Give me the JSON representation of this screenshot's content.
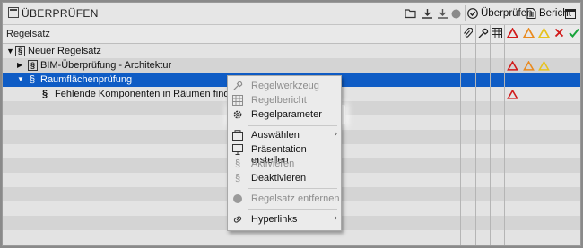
{
  "window": {
    "title": "ÜBERPRÜFEN"
  },
  "toolbar": {
    "icons": [
      "folder-open-icon",
      "download-icon",
      "import-icon",
      "circle-icon",
      "check-shield-icon",
      "document-icon",
      "window-icon"
    ],
    "check_label": "Überprüfen",
    "report_label": "Bericht"
  },
  "columns": {
    "rule_set": "Regelsatz",
    "icons": [
      "paperclip-icon",
      "wrench-icon",
      "grid-icon",
      "red-triangle-icon",
      "orange-triangle-icon",
      "yellow-triangle-icon",
      "red-x-icon",
      "green-check-icon"
    ]
  },
  "tree": [
    {
      "label": "Neuer Regelsatz",
      "expander": "▼",
      "icon": "§"
    },
    {
      "label": "BIM-Überprüfung - Architektur",
      "expander": "▶",
      "icon": "§"
    },
    {
      "label": "Raumflächenprüfung",
      "expander": "▼",
      "icon": "§",
      "selected": true
    },
    {
      "label": "Fehlende Komponenten in Räumen finden",
      "icon": "§"
    }
  ],
  "context_menu": {
    "items": [
      {
        "label": "Regelwerkzeug",
        "icon": "wrench-icon",
        "disabled": true
      },
      {
        "label": "Regelbericht",
        "icon": "report-icon",
        "disabled": true
      },
      {
        "label": "Regelparameter",
        "icon": "gear-icon",
        "disabled": false,
        "highlighted": true
      },
      {
        "label": "Auswählen",
        "icon": "select-icon",
        "disabled": false,
        "submenu": true
      },
      {
        "label": "Präsentation erstellen",
        "icon": "presentation-icon",
        "disabled": false
      },
      {
        "label": "Aktivieren",
        "icon": "section-icon",
        "disabled": true
      },
      {
        "label": "Deaktivieren",
        "icon": "section-icon",
        "disabled": false
      },
      {
        "label": "Regelsatz entfernen",
        "icon": "remove-icon",
        "disabled": true
      },
      {
        "label": "Hyperlinks",
        "icon": "link-icon",
        "disabled": false,
        "submenu": true
      }
    ]
  },
  "colors": {
    "selection": "#0f5cc5",
    "red": "#d11a1a",
    "orange": "#e98a1f",
    "yellow": "#e7c21d",
    "green": "#18a33a"
  }
}
